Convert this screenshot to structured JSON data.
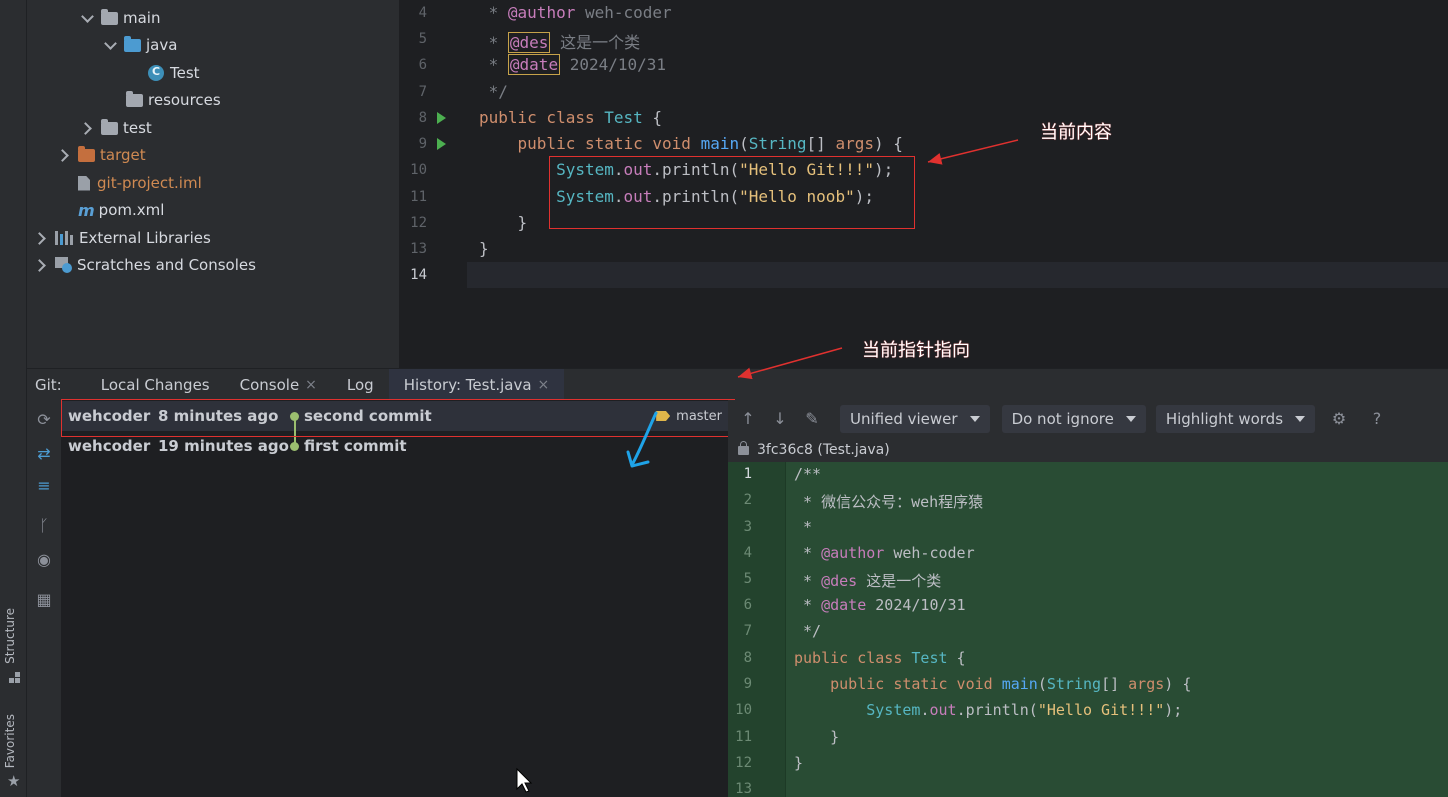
{
  "left_strip": {
    "structure": "Structure",
    "favorites": "Favorites"
  },
  "tree": {
    "items": [
      {
        "label": "main"
      },
      {
        "label": "java"
      },
      {
        "label": "Test"
      },
      {
        "label": "resources"
      },
      {
        "label": "test"
      },
      {
        "label": "target"
      },
      {
        "label": "git-project.iml"
      },
      {
        "label": "pom.xml"
      },
      {
        "label": "External Libraries"
      },
      {
        "label": "Scratches and Consoles"
      }
    ]
  },
  "editor": {
    "line_numbers": [
      "4",
      "5",
      "6",
      "7",
      "8",
      "9",
      "10",
      "11",
      "12",
      "13",
      "14"
    ],
    "l4": {
      "star": " * ",
      "ann": "@author",
      "rest": " weh-coder"
    },
    "l5": {
      "star": " * ",
      "ann": "@des",
      "rest": " 这是一个类"
    },
    "l6": {
      "star": " * ",
      "ann": "@date",
      "rest": " 2024/10/31"
    },
    "l7": " */",
    "l8": {
      "kw": "public class ",
      "cls": "Test",
      "rest": " {"
    },
    "l9": {
      "kw": "    public static void ",
      "fn": "main",
      "p1": "(",
      "cls": "String",
      "p2": "[] ",
      "arg": "args",
      "p3": ") {"
    },
    "l10": {
      "indent": "        ",
      "cls": "System",
      "dot": ".",
      "fld": "out",
      "call": ".println(",
      "str": "\"Hello Git!!!\"",
      "end": ");"
    },
    "l11": {
      "indent": "        ",
      "cls": "System",
      "dot": ".",
      "fld": "out",
      "call": ".println(",
      "str": "\"Hello noob\"",
      "end": ");"
    },
    "l12": "    }",
    "l13": "}"
  },
  "annotations": {
    "current_content": "当前内容",
    "current_pointer": "当前指针指向"
  },
  "tool_window": {
    "label": "Git:",
    "tabs": [
      {
        "label": "Local Changes"
      },
      {
        "label": "Console"
      },
      {
        "label": "Log"
      },
      {
        "label": "History: Test.java"
      }
    ],
    "close_glyph": "×"
  },
  "commits": [
    {
      "author": "wehcoder",
      "time": "8 minutes ago",
      "message": "second commit",
      "tag": "master"
    },
    {
      "author": "wehcoder",
      "time": "19 minutes ago",
      "message": "first commit"
    }
  ],
  "diff": {
    "viewer": "Unified viewer",
    "ignore": "Do not ignore",
    "highlight": "Highlight words",
    "help": "?",
    "header": "3fc36c8 (Test.java)",
    "line_numbers": [
      "1",
      "2",
      "3",
      "4",
      "5",
      "6",
      "7",
      "8",
      "9",
      "10",
      "11",
      "12",
      "13"
    ],
    "d1": "/**",
    "d2": " * 微信公众号：weh程序猿",
    "d3": " *",
    "d4": {
      "star": " * ",
      "ann": "@author",
      "rest": " weh-coder"
    },
    "d5": {
      "star": " * ",
      "ann": "@des",
      "rest": " 这是一个类"
    },
    "d6": {
      "star": " * ",
      "ann": "@date",
      "rest": " 2024/10/31"
    },
    "d7": " */",
    "d8": {
      "kw": "public class ",
      "cls": "Test",
      "rest": " {"
    },
    "d9": {
      "kw": "    public static void ",
      "fn": "main",
      "p1": "(",
      "cls": "String",
      "p2": "[] ",
      "arg": "args",
      "p3": ") {"
    },
    "d10": {
      "indent": "        ",
      "cls": "System",
      "dot": ".",
      "fld": "out",
      "call": ".println(",
      "str": "\"Hello Git!!!\"",
      "end": ");"
    },
    "d11": "    }",
    "d12": "}"
  },
  "colors": {
    "accent": "#3574f0",
    "annotation_red": "#e0312f",
    "annotation_blue": "#1fa3e8",
    "diff_added_bg": "#294c34"
  }
}
